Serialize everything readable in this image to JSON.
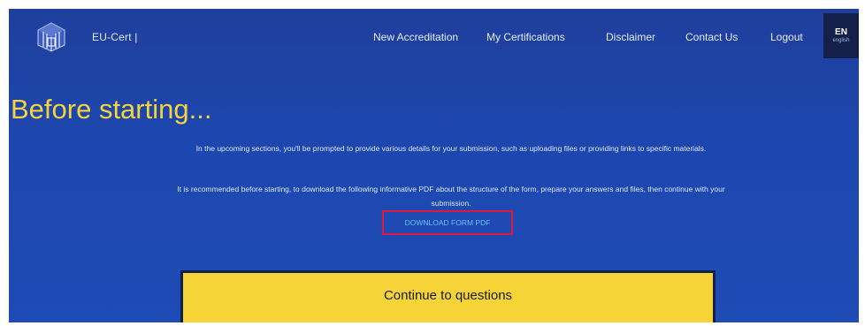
{
  "header": {
    "brand": "EU-Cert |",
    "logo_icon": "cube-logo-icon",
    "nav": [
      {
        "label": "New Accreditation"
      },
      {
        "label": "My Certifications"
      },
      {
        "label": "Disclaimer"
      },
      {
        "label": "Contact Us"
      },
      {
        "label": "Logout"
      }
    ],
    "language": {
      "code": "EN",
      "name": "english"
    }
  },
  "main": {
    "title": "Before starting...",
    "paragraph_1": "In the upcoming sections, you'll be prompted to provide various details for your submission, such as uploading files or providing links to specific materials.",
    "paragraph_2": "It is recommended before starting, to download the following informative PDF about the structure of the form, prepare your answers and files, then continue with your submission.",
    "download_label": "DOWNLOAD FORM PDF",
    "continue_label": "Continue to questions"
  },
  "colors": {
    "background": "#1d47b0",
    "title": "#f4d43a",
    "button": "#f6d437",
    "link": "#67c7f7",
    "highlight_border": "#e0183a",
    "language_badge": "#15204a"
  }
}
